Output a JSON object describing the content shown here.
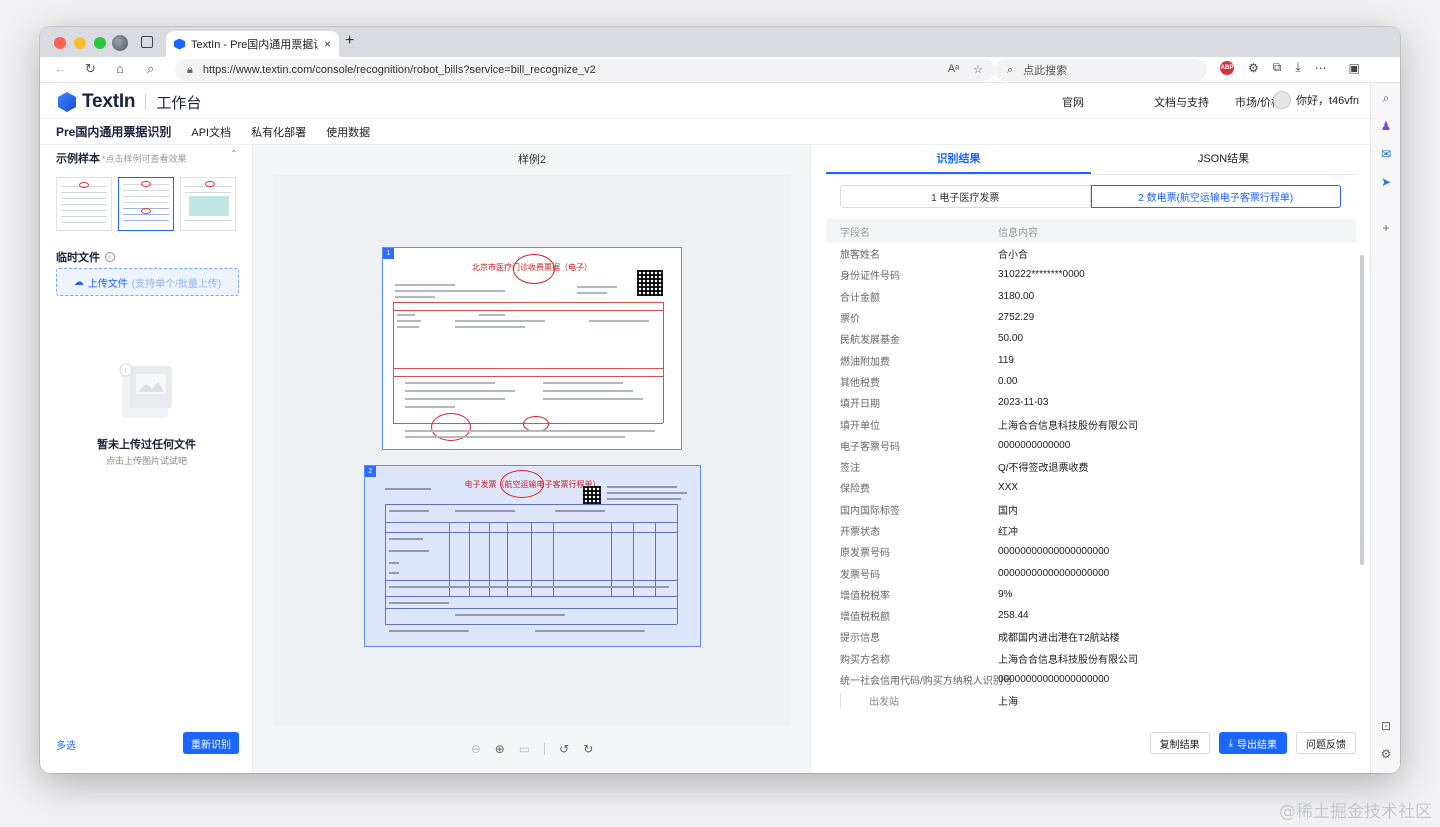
{
  "browser": {
    "tab_title": "TextIn - Pre国内通用票据识别",
    "tab_close": "×",
    "new_tab": "+",
    "url": "https://www.textin.com/console/recognition/robot_bills?service=bill_recognize_v2",
    "search_placeholder": "点此搜索",
    "abp_label": "ABP"
  },
  "header": {
    "logo_text": "TextIn",
    "workbench": "工作台",
    "nav": [
      "官网",
      "文档与支持",
      "市场/价格"
    ],
    "user_greeting": "你好，t46vfn"
  },
  "subnav": {
    "product": "Pre国内通用票据识别",
    "items": [
      "API文档",
      "私有化部署",
      "使用数据"
    ]
  },
  "left": {
    "samples_title": "示例样本",
    "samples_hint": "*点击样例可查看效果",
    "temp_title": "临时文件",
    "upload_label": "上传文件",
    "upload_sub": "(支持单个/批量上传)",
    "empty_title": "暂未上传过任何文件",
    "empty_sub": "点击上传图片试试吧",
    "multi_label": "多选",
    "rerecognize_label": "重新识别"
  },
  "middle": {
    "title": "样例2",
    "doc1": {
      "num": "1",
      "title": "北京市医疗门诊收费票据（电子）"
    },
    "doc2": {
      "num": "2",
      "title": "电子发票（航空运输电子客票行程单）"
    }
  },
  "right": {
    "tabs": [
      "识别结果",
      "JSON结果"
    ],
    "segments": [
      "1 电子医疗发票",
      "2 数电票(航空运输电子客票行程单)"
    ],
    "table_headers": [
      "字段名",
      "信息内容"
    ],
    "rows": [
      [
        "旅客姓名",
        "合小合"
      ],
      [
        "身份证件号码",
        "310222********0000"
      ],
      [
        "合计金额",
        "3180.00"
      ],
      [
        "票价",
        "2752.29"
      ],
      [
        "民航发展基金",
        "50.00"
      ],
      [
        "燃油附加费",
        "119"
      ],
      [
        "其他税费",
        "0.00"
      ],
      [
        "填开日期",
        "2023-11-03"
      ],
      [
        "填开单位",
        "上海合合信息科技股份有限公司"
      ],
      [
        "电子客票号码",
        "0000000000000"
      ],
      [
        "签注",
        "Q/不得签改退票收费"
      ],
      [
        "保险费",
        "XXX"
      ],
      [
        "国内国际标签",
        "国内"
      ],
      [
        "开票状态",
        "红冲"
      ],
      [
        "原发票号码",
        "00000000000000000000"
      ],
      [
        "发票号码",
        "00000000000000000000"
      ],
      [
        "增值税税率",
        "9%"
      ],
      [
        "增值税税额",
        "258.44"
      ],
      [
        "提示信息",
        "成都国内进出港在T2航站楼"
      ],
      [
        "购买方名称",
        "上海合合信息科技股份有限公司"
      ],
      [
        "统一社会信用代码/购买方纳税人识别号",
        "00000000000000000000"
      ]
    ],
    "sub_row": [
      "出发站",
      "上海"
    ],
    "actions": {
      "copy": "复制结果",
      "export": "导出结果",
      "feedback": "问题反馈"
    }
  },
  "watermark": "@稀土掘金技术社区"
}
